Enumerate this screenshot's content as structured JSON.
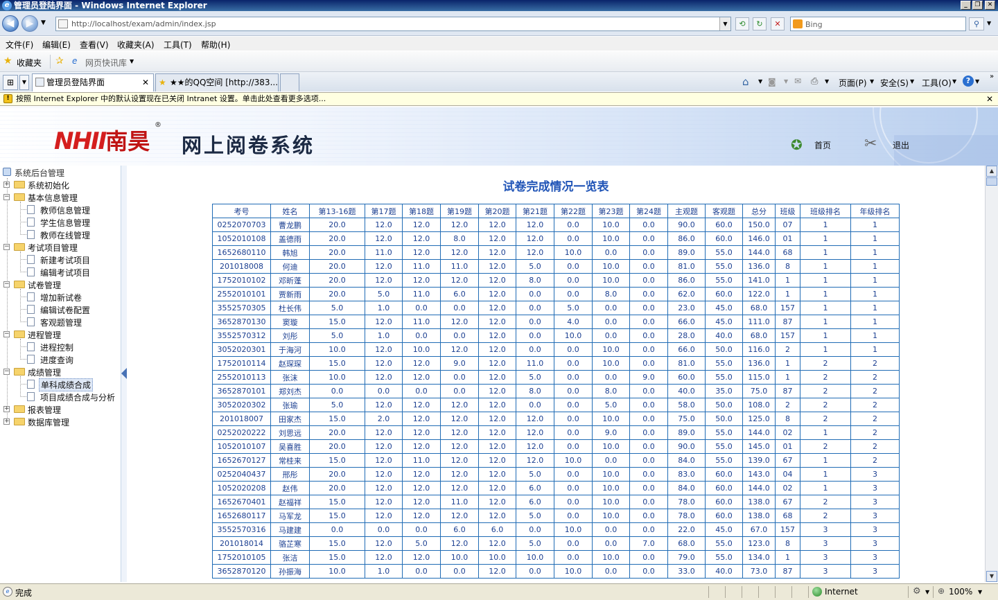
{
  "window": {
    "title": "管理员登陆界面 - Windows Internet Explorer"
  },
  "address": {
    "url": "http://localhost/exam/admin/index.jsp",
    "search_placeholder": "Bing"
  },
  "menu": [
    "文件(F)",
    "编辑(E)",
    "查看(V)",
    "收藏夹(A)",
    "工具(T)",
    "帮助(H)"
  ],
  "favorites": {
    "label": "收藏夹",
    "quick": "网页快讯库"
  },
  "tabs": [
    {
      "label": "管理员登陆界面"
    },
    {
      "label": "★★的QQ空间 [http://383..."
    }
  ],
  "commandbar": {
    "page": "页面(P)",
    "safety": "安全(S)",
    "tools": "工具(O)"
  },
  "infobar": {
    "text": "按照 Internet Explorer 中的默认设置现在已关闭 Intranet 设置。单击此处查看更多选项..."
  },
  "banner": {
    "logo_mark": "NHII",
    "logo_name": "南昊",
    "reg": "®",
    "system_title": "网上阅卷系统",
    "home": "首页",
    "logout": "退出"
  },
  "sidebar": {
    "root": "系统后台管理",
    "groups": [
      {
        "label": "系统初始化",
        "expanded": false,
        "items": []
      },
      {
        "label": "基本信息管理",
        "expanded": true,
        "items": [
          "教师信息管理",
          "学生信息管理",
          "教师在线管理"
        ]
      },
      {
        "label": "考试项目管理",
        "expanded": true,
        "items": [
          "新建考试项目",
          "编辑考试项目"
        ]
      },
      {
        "label": "试卷管理",
        "expanded": true,
        "items": [
          "增加新试卷",
          "编辑试卷配置",
          "客观题管理"
        ]
      },
      {
        "label": "进程管理",
        "expanded": true,
        "items": [
          "进程控制",
          "进度查询"
        ]
      },
      {
        "label": "成绩管理",
        "expanded": true,
        "items": [
          "单科成绩合成",
          "项目成绩合成与分析"
        ]
      },
      {
        "label": "报表管理",
        "expanded": false,
        "items": []
      },
      {
        "label": "数据库管理",
        "expanded": false,
        "items": []
      }
    ],
    "selected": "单科成绩合成"
  },
  "main": {
    "title": "试卷完成情况一览表",
    "columns": [
      "考号",
      "姓名",
      "第13-16题",
      "第17题",
      "第18题",
      "第19题",
      "第20题",
      "第21题",
      "第22题",
      "第23题",
      "第24题",
      "主观题",
      "客观题",
      "总分",
      "班级",
      "班级排名",
      "年级排名"
    ],
    "rows": [
      [
        "0252070703",
        "曹龙鹏",
        "20.0",
        "12.0",
        "12.0",
        "12.0",
        "12.0",
        "12.0",
        "0.0",
        "10.0",
        "0.0",
        "90.0",
        "60.0",
        "150.0",
        "07",
        "1",
        "1"
      ],
      [
        "1052010108",
        "盖德雨",
        "20.0",
        "12.0",
        "12.0",
        "8.0",
        "12.0",
        "12.0",
        "0.0",
        "10.0",
        "0.0",
        "86.0",
        "60.0",
        "146.0",
        "01",
        "1",
        "1"
      ],
      [
        "1652680110",
        "韩旭",
        "20.0",
        "11.0",
        "12.0",
        "12.0",
        "12.0",
        "12.0",
        "10.0",
        "0.0",
        "0.0",
        "89.0",
        "55.0",
        "144.0",
        "68",
        "1",
        "1"
      ],
      [
        "201018008",
        "何迪",
        "20.0",
        "12.0",
        "11.0",
        "11.0",
        "12.0",
        "5.0",
        "0.0",
        "10.0",
        "0.0",
        "81.0",
        "55.0",
        "136.0",
        "8",
        "1",
        "1"
      ],
      [
        "1752010102",
        "邓昕蓬",
        "20.0",
        "12.0",
        "12.0",
        "12.0",
        "12.0",
        "8.0",
        "0.0",
        "10.0",
        "0.0",
        "86.0",
        "55.0",
        "141.0",
        "1",
        "1",
        "1"
      ],
      [
        "2552010101",
        "贾新雨",
        "20.0",
        "5.0",
        "11.0",
        "6.0",
        "12.0",
        "0.0",
        "0.0",
        "8.0",
        "0.0",
        "62.0",
        "60.0",
        "122.0",
        "1",
        "1",
        "1"
      ],
      [
        "3552570305",
        "杜长伟",
        "5.0",
        "1.0",
        "0.0",
        "0.0",
        "12.0",
        "0.0",
        "5.0",
        "0.0",
        "0.0",
        "23.0",
        "45.0",
        "68.0",
        "157",
        "1",
        "1"
      ],
      [
        "3652870130",
        "窦璇",
        "15.0",
        "12.0",
        "11.0",
        "12.0",
        "12.0",
        "0.0",
        "4.0",
        "0.0",
        "0.0",
        "66.0",
        "45.0",
        "111.0",
        "87",
        "1",
        "1"
      ],
      [
        "3552570312",
        "刘彤",
        "5.0",
        "1.0",
        "0.0",
        "0.0",
        "12.0",
        "0.0",
        "10.0",
        "0.0",
        "0.0",
        "28.0",
        "40.0",
        "68.0",
        "157",
        "1",
        "1"
      ],
      [
        "3052020301",
        "于海河",
        "10.0",
        "12.0",
        "10.0",
        "12.0",
        "12.0",
        "0.0",
        "0.0",
        "10.0",
        "0.0",
        "66.0",
        "50.0",
        "116.0",
        "2",
        "1",
        "1"
      ],
      [
        "1752010114",
        "赵琛琛",
        "15.0",
        "12.0",
        "12.0",
        "9.0",
        "12.0",
        "11.0",
        "0.0",
        "10.0",
        "0.0",
        "81.0",
        "55.0",
        "136.0",
        "1",
        "2",
        "2"
      ],
      [
        "2552010113",
        "张沫",
        "10.0",
        "12.0",
        "12.0",
        "0.0",
        "12.0",
        "5.0",
        "0.0",
        "0.0",
        "9.0",
        "60.0",
        "55.0",
        "115.0",
        "1",
        "2",
        "2"
      ],
      [
        "3652870101",
        "郑刘杰",
        "0.0",
        "0.0",
        "0.0",
        "0.0",
        "12.0",
        "8.0",
        "0.0",
        "8.0",
        "0.0",
        "40.0",
        "35.0",
        "75.0",
        "87",
        "2",
        "2"
      ],
      [
        "3052020302",
        "张瑜",
        "5.0",
        "12.0",
        "12.0",
        "12.0",
        "12.0",
        "0.0",
        "0.0",
        "5.0",
        "0.0",
        "58.0",
        "50.0",
        "108.0",
        "2",
        "2",
        "2"
      ],
      [
        "201018007",
        "田家杰",
        "15.0",
        "2.0",
        "12.0",
        "12.0",
        "12.0",
        "12.0",
        "0.0",
        "10.0",
        "0.0",
        "75.0",
        "50.0",
        "125.0",
        "8",
        "2",
        "2"
      ],
      [
        "0252020222",
        "刘思远",
        "20.0",
        "12.0",
        "12.0",
        "12.0",
        "12.0",
        "12.0",
        "0.0",
        "9.0",
        "0.0",
        "89.0",
        "55.0",
        "144.0",
        "02",
        "1",
        "2"
      ],
      [
        "1052010107",
        "吴喜胜",
        "20.0",
        "12.0",
        "12.0",
        "12.0",
        "12.0",
        "12.0",
        "0.0",
        "10.0",
        "0.0",
        "90.0",
        "55.0",
        "145.0",
        "01",
        "2",
        "2"
      ],
      [
        "1652670127",
        "常桂来",
        "15.0",
        "12.0",
        "11.0",
        "12.0",
        "12.0",
        "12.0",
        "10.0",
        "0.0",
        "0.0",
        "84.0",
        "55.0",
        "139.0",
        "67",
        "1",
        "2"
      ],
      [
        "0252040437",
        "邢彤",
        "20.0",
        "12.0",
        "12.0",
        "12.0",
        "12.0",
        "5.0",
        "0.0",
        "10.0",
        "0.0",
        "83.0",
        "60.0",
        "143.0",
        "04",
        "1",
        "3"
      ],
      [
        "1052020208",
        "赵伟",
        "20.0",
        "12.0",
        "12.0",
        "12.0",
        "12.0",
        "6.0",
        "0.0",
        "10.0",
        "0.0",
        "84.0",
        "60.0",
        "144.0",
        "02",
        "1",
        "3"
      ],
      [
        "1652670401",
        "赵福祥",
        "15.0",
        "12.0",
        "12.0",
        "11.0",
        "12.0",
        "6.0",
        "0.0",
        "10.0",
        "0.0",
        "78.0",
        "60.0",
        "138.0",
        "67",
        "2",
        "3"
      ],
      [
        "1652680117",
        "马军龙",
        "15.0",
        "12.0",
        "12.0",
        "12.0",
        "12.0",
        "5.0",
        "0.0",
        "10.0",
        "0.0",
        "78.0",
        "60.0",
        "138.0",
        "68",
        "2",
        "3"
      ],
      [
        "3552570316",
        "马建建",
        "0.0",
        "0.0",
        "0.0",
        "6.0",
        "6.0",
        "0.0",
        "10.0",
        "0.0",
        "0.0",
        "22.0",
        "45.0",
        "67.0",
        "157",
        "3",
        "3"
      ],
      [
        "201018014",
        "骆芷寒",
        "15.0",
        "12.0",
        "5.0",
        "12.0",
        "12.0",
        "5.0",
        "0.0",
        "0.0",
        "7.0",
        "68.0",
        "55.0",
        "123.0",
        "8",
        "3",
        "3"
      ],
      [
        "1752010105",
        "张洁",
        "15.0",
        "12.0",
        "12.0",
        "10.0",
        "10.0",
        "10.0",
        "0.0",
        "10.0",
        "0.0",
        "79.0",
        "55.0",
        "134.0",
        "1",
        "3",
        "3"
      ],
      [
        "3652870120",
        "孙振海",
        "10.0",
        "1.0",
        "0.0",
        "0.0",
        "12.0",
        "0.0",
        "10.0",
        "0.0",
        "0.0",
        "33.0",
        "40.0",
        "73.0",
        "87",
        "3",
        "3"
      ]
    ]
  },
  "status": {
    "text": "完成",
    "zone": "Internet",
    "zoom": "100%"
  }
}
